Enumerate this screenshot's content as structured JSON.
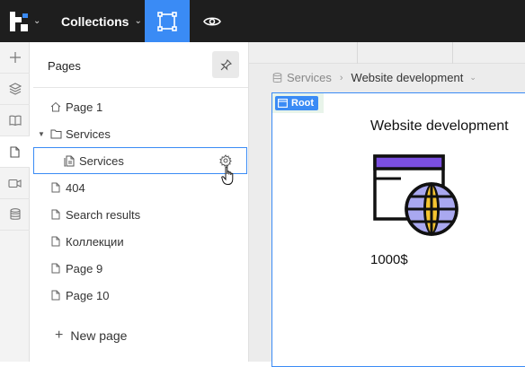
{
  "topbar": {
    "project_label": "Collections"
  },
  "rail": {
    "items": [
      "add-icon",
      "layers-icon",
      "book-icon",
      "page-icon",
      "video-icon",
      "database-icon"
    ],
    "active": "page-icon"
  },
  "pages_panel": {
    "title": "Pages",
    "pages": [
      {
        "label": "Page 1",
        "icon": "home-icon"
      },
      {
        "label": "Services",
        "icon": "folder-icon"
      },
      {
        "label": "Services",
        "icon": "pages-icon"
      },
      {
        "label": "404",
        "icon": "page-icon"
      },
      {
        "label": "Search results",
        "icon": "page-icon"
      },
      {
        "label": "Коллекции",
        "icon": "page-icon"
      },
      {
        "label": "Page 9",
        "icon": "page-icon"
      },
      {
        "label": "Page 10",
        "icon": "page-icon"
      }
    ],
    "new_page_label": "New page"
  },
  "breadcrumb": {
    "parent": "Services",
    "current": "Website development"
  },
  "canvas": {
    "root_label": "Root",
    "heading": "Website development",
    "price": "1000$"
  },
  "colors": {
    "accent": "#3a8bf5",
    "topbar": "#1e1e1e",
    "illustration_purple": "#7b4fe0",
    "globe_fill": "#a9a8f0",
    "globe_yellow": "#f5c430"
  }
}
